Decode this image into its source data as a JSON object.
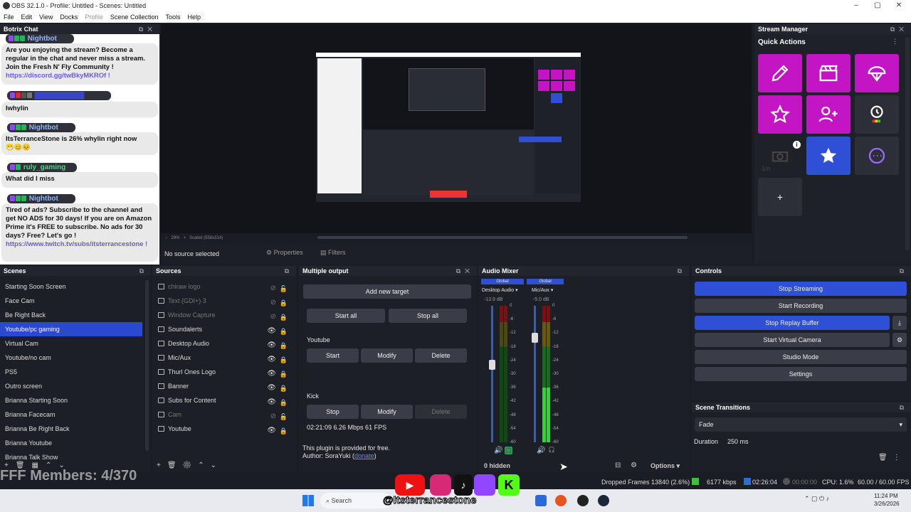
{
  "window": {
    "title": "OBS 32.1.0 - Profile: Untitled - Scenes: Untitled"
  },
  "menu": [
    "File",
    "Edit",
    "View",
    "Docks",
    "Profile",
    "Scene Collection",
    "Tools",
    "Help"
  ],
  "chat": {
    "title": "Botrix Chat",
    "messages": [
      {
        "user": "Nightbot",
        "text": "Are you enjoying the stream? Become a regular in the chat and never miss a stream. Join the Fresh N' Fly Community !",
        "link": "https://discord.gg/twBkyMKROf !"
      },
      {
        "user": "",
        "text": "Iwhylin"
      },
      {
        "user": "Nightbot",
        "text": "ItsTerranceStone is 26% whylin right now",
        "emotes": "😁😊😣"
      },
      {
        "user": "ruly_gaming",
        "text": "What did I miss"
      },
      {
        "user": "Nightbot",
        "text": "Tired of ads? Subscribe to the channel and get NO ADS for 30 days! If you are on Amazon Prime it's FREE to subscribe. No ads for 30 days? Free? Let's go !",
        "link": "https://www.twitch.tv/subs/itsterrancestone !"
      }
    ]
  },
  "preview": {
    "zoom": "29%",
    "scaled": "Scaled (558x314)",
    "no_source": "No source selected",
    "properties": "Properties",
    "filters": "Filters"
  },
  "stream_manager": {
    "title": "Stream Manager",
    "quick_actions": "Quick Actions",
    "badge_1m": "1m",
    "add": "+"
  },
  "scenes": {
    "title": "Scenes",
    "items": [
      "Starting Soon Screen",
      "Face Cam",
      "Be Right Back",
      "Youtube/pc gaming",
      "Virtual Cam",
      "Youtube/no cam",
      "PS5",
      "Outro screen",
      "Brianna Starting Soon",
      "Brianna Facecam",
      "Brianna Be Right Back",
      "Brianna Youtube",
      "Brianna Talk Show"
    ],
    "selected_index": 3
  },
  "sources": {
    "title": "Sources",
    "items": [
      {
        "name": "chiraw logo",
        "dim": true
      },
      {
        "name": "Text (GDI+) 3",
        "dim": true
      },
      {
        "name": "Window Capture",
        "dim": true
      },
      {
        "name": "Soundalerts",
        "dim": false
      },
      {
        "name": "Desktop Audio",
        "dim": false
      },
      {
        "name": "Mic/Aux",
        "dim": false
      },
      {
        "name": "Thurl Ones Logo",
        "dim": false
      },
      {
        "name": "Banner",
        "dim": false
      },
      {
        "name": "Subs for Content",
        "dim": false
      },
      {
        "name": "Cam",
        "dim": true
      },
      {
        "name": "Youtube",
        "dim": false
      }
    ]
  },
  "multi_output": {
    "title": "Multiple output",
    "add_target": "Add new target",
    "start_all": "Start all",
    "stop_all": "Stop all",
    "youtube": {
      "name": "Youtube",
      "start": "Start",
      "modify": "Modify",
      "delete": "Delete"
    },
    "kick": {
      "name": "Kick",
      "stop": "Stop",
      "modify": "Modify",
      "delete": "Delete",
      "stats": "02:21:09  6.26 Mbps  61 FPS"
    },
    "plugin_note": "This plugin is provided for free.",
    "author": "Author: SoraYuki (",
    "donate": "donate",
    "author_end": ")"
  },
  "audio_mixer": {
    "title": "Audio Mixer",
    "channels": [
      {
        "global": "Global",
        "name": "Desktop Audio",
        "db": "-13.9 dB",
        "fader": 0.31
      },
      {
        "global": "Global",
        "name": "Mic/Aux",
        "db": "-5.0 dB",
        "fader": 0.77
      }
    ],
    "scale": [
      "0",
      "-6",
      "-12",
      "-18",
      "-24",
      "-30",
      "-36",
      "-42",
      "-48",
      "-54",
      "-60"
    ],
    "hidden": "0 hidden",
    "options": "Options"
  },
  "controls": {
    "title": "Controls",
    "buttons": [
      "Stop Streaming",
      "Start Recording",
      "Stop Replay Buffer",
      "Start Virtual Camera",
      "Studio Mode",
      "Settings"
    ]
  },
  "transitions": {
    "title": "Scene Transitions",
    "type": "Fade",
    "duration_label": "Duration",
    "duration": "250 ms"
  },
  "status": {
    "dropped": "Dropped Frames 13840 (2.6%)",
    "kbps": "6177 kbps",
    "stream_time": "02:26:04",
    "rec_time": "00:00:00",
    "cpu": "CPU: 1.6%",
    "fps": "60.00 / 60.00 FPS"
  },
  "overlay": {
    "members": "FFF Members: 4/370",
    "handle": "@Itsterrancestone"
  },
  "taskbar": {
    "search": "Search",
    "time": "11:24 PM",
    "date": "3/26/2026"
  },
  "colors": {
    "accent_blue": "#2e4fd6",
    "magenta": "#c415c4",
    "twitch_purple": "#7b4bd6"
  }
}
